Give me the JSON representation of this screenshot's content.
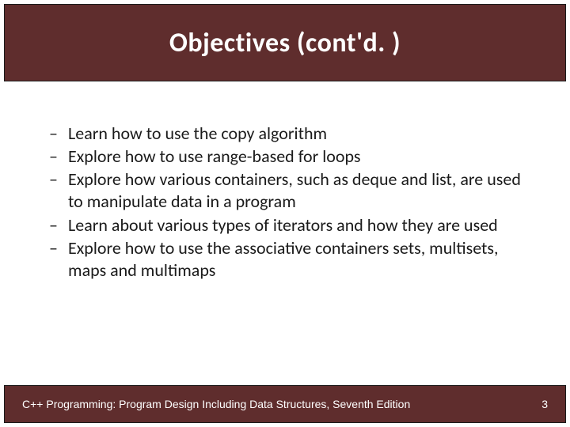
{
  "title": "Objectives (cont'd. )",
  "bullets": [
    "Learn how to use the copy algorithm",
    "Explore how to use range-based for loops",
    "Explore how various containers, such as deque and list, are used to manipulate data in a program",
    "Learn about various types of iterators and how they are used",
    "Explore how to use the associative containers sets, multisets, maps and multimaps"
  ],
  "footer": {
    "book": "C++ Programming: Program Design Including Data Structures, Seventh Edition",
    "page": "3"
  },
  "colors": {
    "band": "#5f2d2d",
    "text": "#1b1b1b",
    "title_text": "#ffffff"
  }
}
